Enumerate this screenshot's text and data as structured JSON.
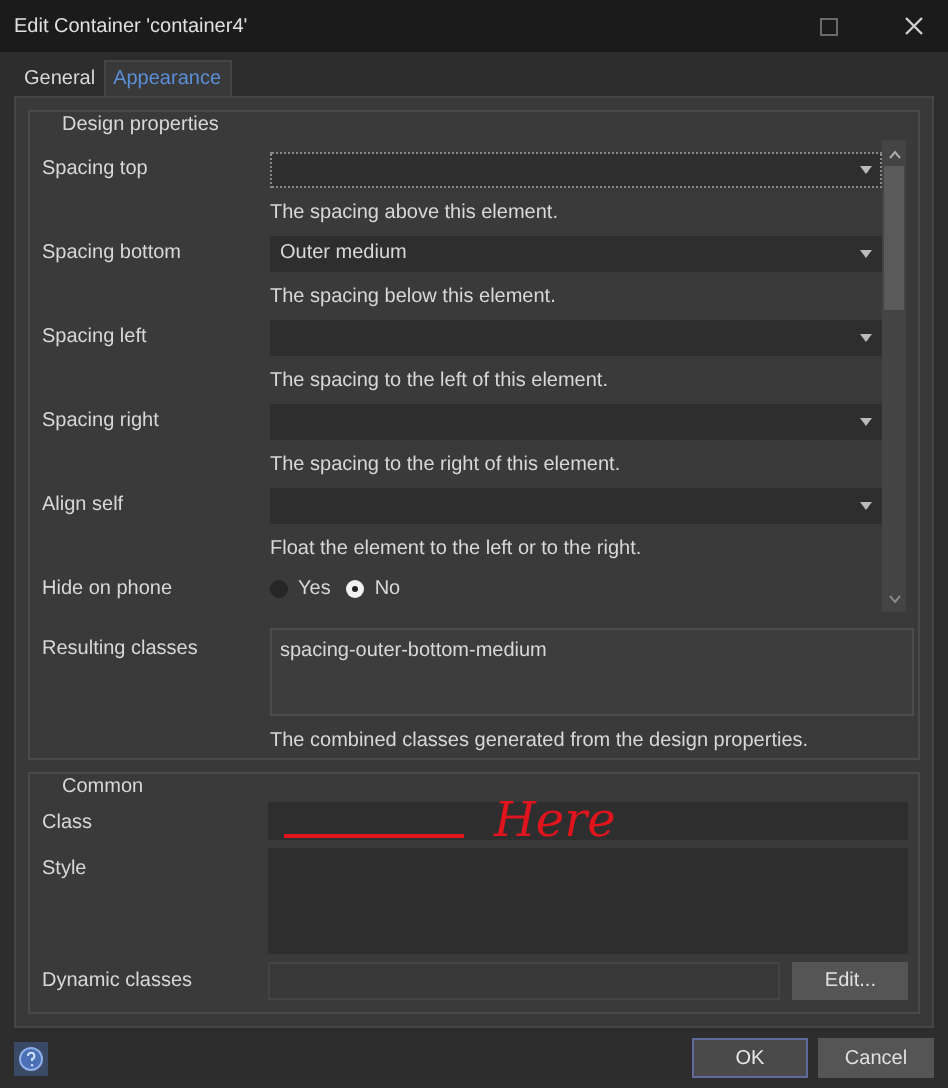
{
  "window": {
    "title": "Edit Container 'container4'"
  },
  "tabs": [
    {
      "label": "General",
      "selected": false
    },
    {
      "label": "Appearance",
      "selected": true
    }
  ],
  "design_properties": {
    "title": "Design properties",
    "rows": [
      {
        "kind": "dropdown",
        "label": "Spacing top",
        "value": null,
        "focused": true,
        "help": "The spacing above this element."
      },
      {
        "kind": "dropdown",
        "label": "Spacing bottom",
        "value": "Outer medium",
        "focused": false,
        "help": "The spacing below this element."
      },
      {
        "kind": "dropdown",
        "label": "Spacing left",
        "value": null,
        "focused": false,
        "help": "The spacing to the left of this element."
      },
      {
        "kind": "dropdown",
        "label": "Spacing right",
        "value": null,
        "focused": false,
        "help": "The spacing to the right of this element."
      },
      {
        "kind": "dropdown",
        "label": "Align self",
        "value": null,
        "focused": false,
        "help": "Float the element to the left or to the right."
      },
      {
        "kind": "radio",
        "label": "Hide on phone",
        "options": [
          {
            "label": "Yes",
            "selected": false
          },
          {
            "label": "No",
            "selected": true
          }
        ]
      }
    ],
    "resulting_classes": {
      "label": "Resulting classes",
      "value": "spacing-outer-bottom-medium",
      "help": "The combined classes generated from the design properties."
    }
  },
  "common": {
    "title": "Common",
    "class_label": "Class",
    "style_label": "Style",
    "dynamic_label": "Dynamic classes",
    "edit_button": "Edit..."
  },
  "annotation": {
    "text": "Here"
  },
  "buttons": [
    {
      "label": "OK",
      "selected": true
    },
    {
      "label": "Cancel",
      "selected": false
    }
  ]
}
